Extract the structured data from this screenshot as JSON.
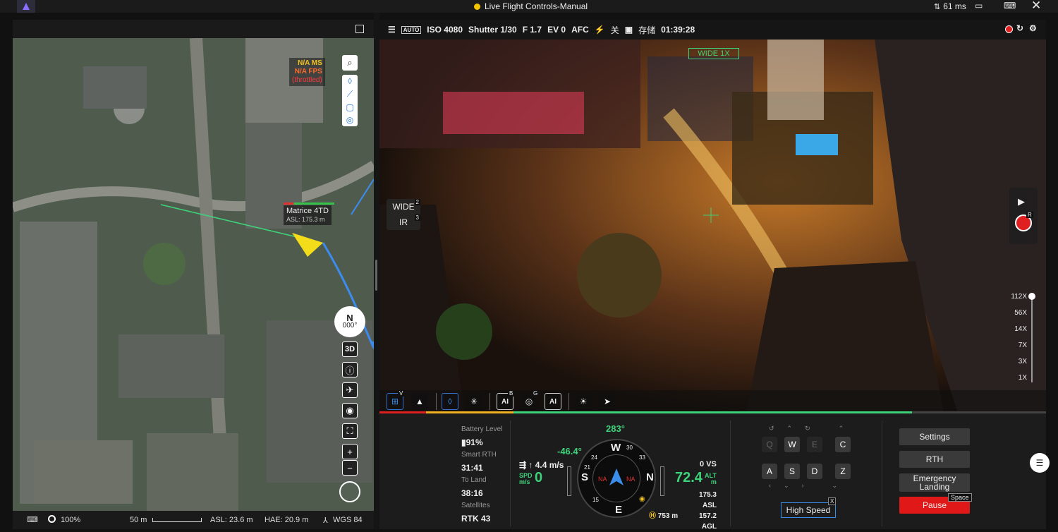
{
  "titlebar": {
    "title": "Live Flight Controls-Manual",
    "latency": "61 ms"
  },
  "map": {
    "perf_ms": "N/A MS",
    "perf_fps": "N/A FPS",
    "perf_note": "(throttled)",
    "aircraft_name": "Matrice 4TD",
    "aircraft_asl": "ASL: 175.3 m",
    "compass_n": "N",
    "compass_deg": "000°",
    "btn_3d": "3D",
    "status": {
      "zoom": "100%",
      "scale": "50 m",
      "asl": "ASL: 23.6 m",
      "hae": "HAE: 20.9 m",
      "datum": "WGS 84"
    }
  },
  "camera": {
    "header": {
      "auto": "AUTO",
      "iso": "ISO 4080",
      "shutter": "Shutter 1/30",
      "fstop": "F 1.7",
      "ev": "EV 0",
      "afc": "AFC",
      "off": "关",
      "storage": "存储",
      "time": "01:39:28"
    },
    "wide_label": "WIDE 1X",
    "lens": {
      "wide": "WIDE",
      "wide_key": "2",
      "ir": "IR",
      "ir_key": "3"
    },
    "rec_badge": "R",
    "zoom_levels": [
      "112X",
      "56X",
      "14X",
      "7X",
      "3X",
      "1X"
    ],
    "tools": {
      "v": "V",
      "b": "B",
      "g": "G"
    }
  },
  "telemetry": {
    "battery_label": "Battery Level",
    "battery": "91%",
    "smart_rth_label": "Smart RTH",
    "smart_rth": "31:41",
    "to_land_label": "To Land",
    "to_land": "38:16",
    "satellites_label": "Satellites",
    "satellites": "RTK 43",
    "heading": "283°",
    "gimbal_pitch": "-46.4°",
    "hspeed": "4.4 m/s",
    "spd_label": "SPD",
    "spd_unit": "m/s",
    "spd": "0",
    "vs": "0 VS",
    "alt": "72.4",
    "alt_label": "ALT",
    "alt_unit": "m",
    "asl": "175.3 ASL",
    "agl": "157.2 AGL",
    "home_dist": "753 m",
    "na_left": "NA",
    "na_right": "NA",
    "compass": {
      "W": "W",
      "S": "S",
      "N": "N",
      "E": "E",
      "d30": "30",
      "d33": "33",
      "d24": "24",
      "d21": "21",
      "d15": "15"
    }
  },
  "keys": {
    "Q": "Q",
    "W": "W",
    "E": "E",
    "C": "C",
    "A": "A",
    "S": "S",
    "D": "D",
    "Z": "Z",
    "high_speed": "High Speed",
    "hs_close": "X"
  },
  "actions": {
    "settings": "Settings",
    "rth": "RTH",
    "emergency": "Emergency Landing",
    "pause": "Pause",
    "space": "Space"
  }
}
